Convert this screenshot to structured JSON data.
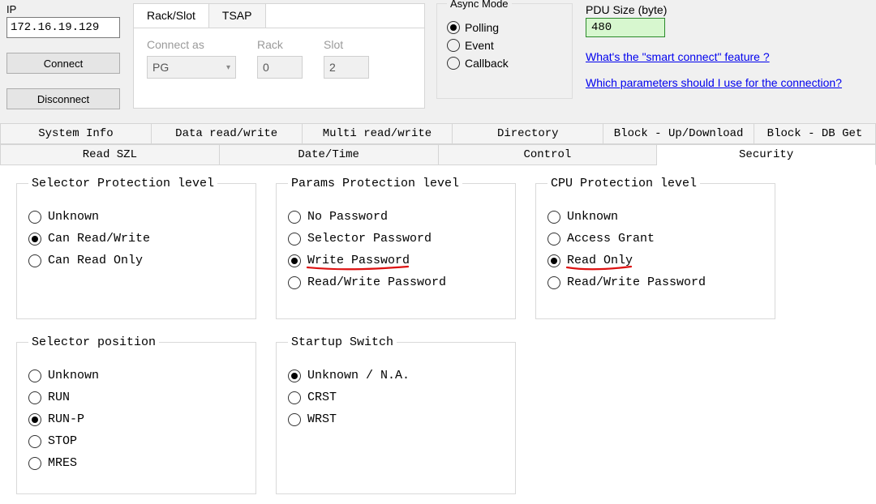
{
  "ip": {
    "label": "IP",
    "value": "172.16.19.129"
  },
  "buttons": {
    "connect": "Connect",
    "disconnect": "Disconnect"
  },
  "rack_card": {
    "tabs": [
      "Rack/Slot",
      "TSAP"
    ],
    "connect_as_label": "Connect as",
    "connect_as_value": "PG",
    "rack_label": "Rack",
    "rack_value": "0",
    "slot_label": "Slot",
    "slot_value": "2"
  },
  "async": {
    "legend": "Async Mode",
    "opts": [
      "Polling",
      "Event",
      "Callback"
    ],
    "selected": 0
  },
  "pdu": {
    "label": "PDU Size (byte)",
    "value": "480",
    "link1": "What's the \"smart connect\" feature ?",
    "link2": "Which parameters should I use for the connection?"
  },
  "tabs_row1": [
    "System Info",
    "Data read/write",
    "Multi read/write",
    "Directory",
    "Block - Up/Download",
    "Block - DB Get"
  ],
  "tabs_row2": [
    "Read SZL",
    "Date/Time",
    "Control",
    "Security"
  ],
  "tabs_row2_active": 3,
  "panels": {
    "selector_protection": {
      "legend": "Selector Protection level",
      "opts": [
        "Unknown",
        "Can Read/Write",
        "Can Read Only"
      ],
      "selected": 1
    },
    "params_protection": {
      "legend": "Params Protection level",
      "opts": [
        "No Password",
        "Selector Password",
        "Write Password",
        "Read/Write Password"
      ],
      "selected": 2
    },
    "cpu_protection": {
      "legend": "CPU Protection level",
      "opts": [
        "Unknown",
        "Access Grant",
        "Read Only",
        "Read/Write Password"
      ],
      "selected": 2
    },
    "selector_position": {
      "legend": "Selector position",
      "opts": [
        "Unknown",
        "RUN",
        "RUN-P",
        "STOP",
        "MRES"
      ],
      "selected": 2
    },
    "startup_switch": {
      "legend": "Startup Switch",
      "opts": [
        "Unknown / N.A.",
        "CRST",
        "WRST"
      ],
      "selected": 0
    }
  }
}
